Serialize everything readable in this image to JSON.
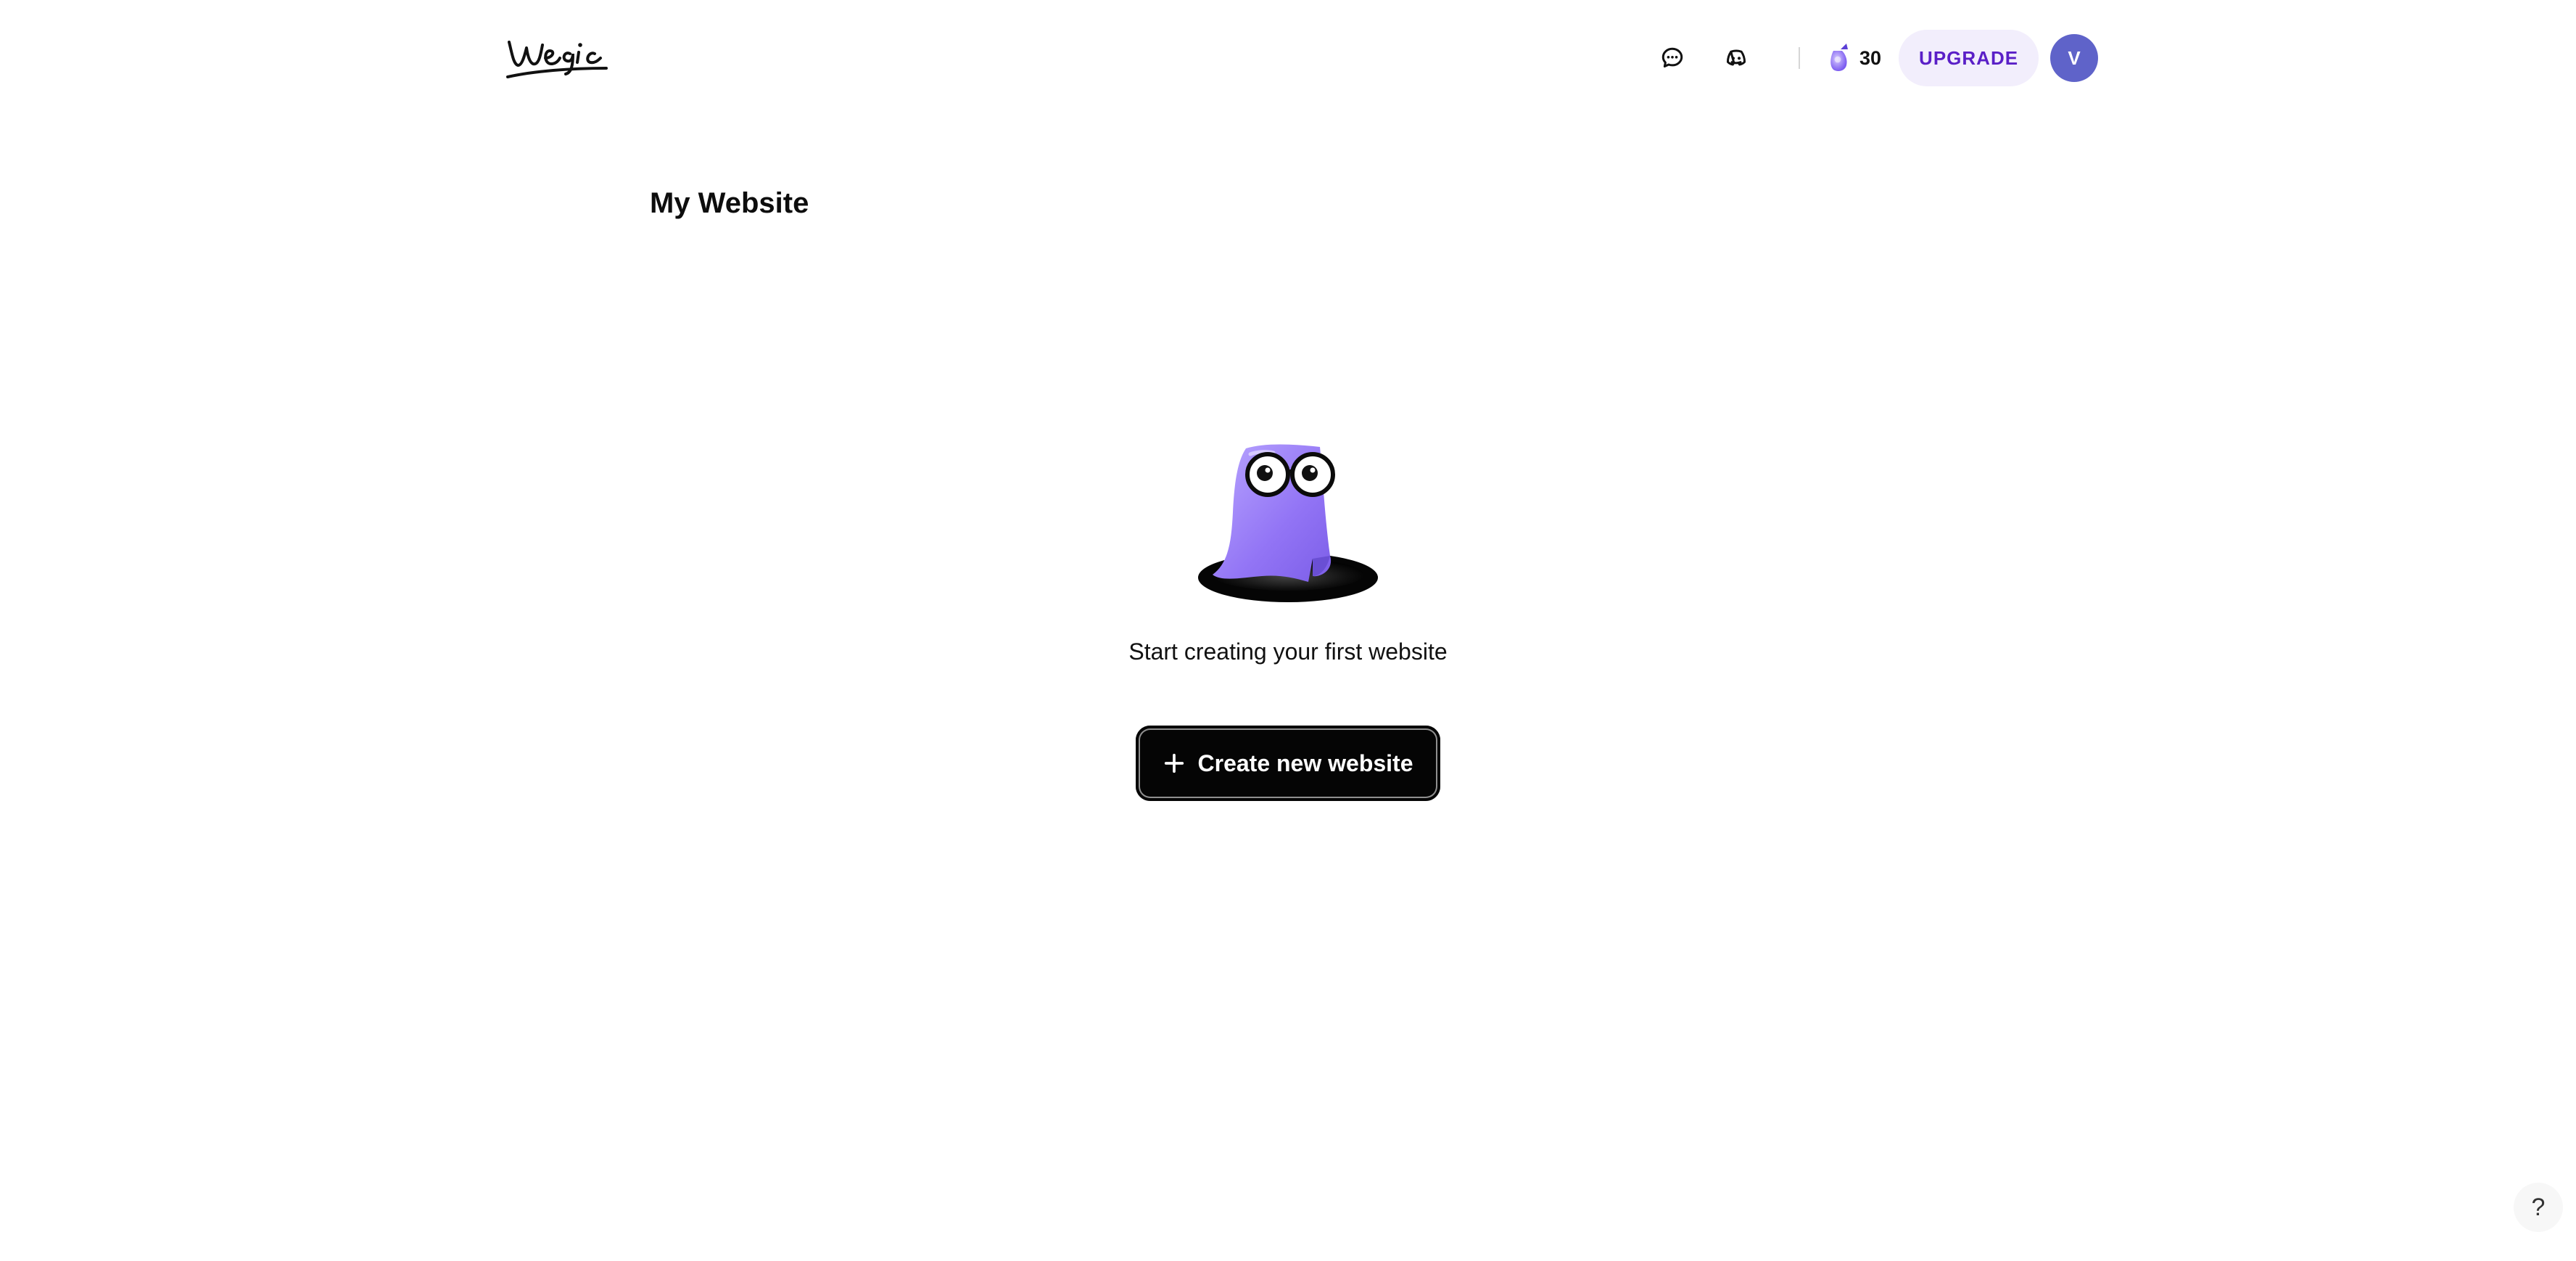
{
  "header": {
    "logo_text": "Wegic",
    "credits_count": "30",
    "upgrade_label": "UPGRADE",
    "avatar_initial": "V",
    "icons": {
      "chat": "chat-bubble-icon",
      "discord": "discord-icon",
      "credits": "credit-token-icon"
    }
  },
  "main": {
    "title": "My Website",
    "empty_state": {
      "illustration": "purple-ghost-mascot",
      "message": "Start creating your first website",
      "create_button_label": "Create new website"
    }
  },
  "help": {
    "label": "?"
  },
  "colors": {
    "accent": "#5a1fc7",
    "upgrade_bg": "#f2eefc",
    "avatar_bg": "#5f63c9",
    "button_bg": "#050505",
    "mascot": "#9b82f5"
  }
}
